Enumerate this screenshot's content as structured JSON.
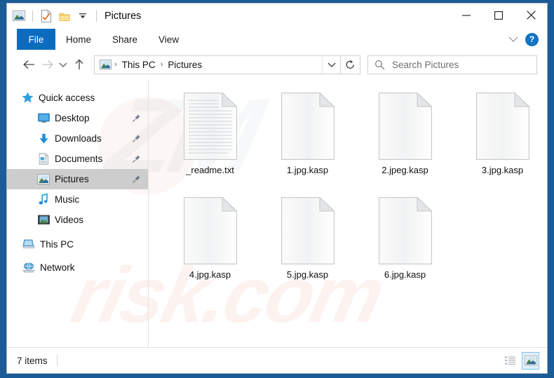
{
  "window": {
    "title": "Pictures",
    "quick_access_toolbar": [
      {
        "name": "pictures-folder-icon",
        "label": "Pictures"
      },
      {
        "name": "properties-icon",
        "label": "Properties"
      },
      {
        "name": "new-folder-icon",
        "label": "New folder"
      },
      {
        "name": "customize-dropdown-icon",
        "label": "Customize Quick Access Toolbar"
      }
    ],
    "controls": {
      "minimize": "—",
      "maximize": "☐",
      "close": "✕"
    }
  },
  "ribbon": {
    "tabs": [
      {
        "label": "File",
        "active": true
      },
      {
        "label": "Home",
        "active": false
      },
      {
        "label": "Share",
        "active": false
      },
      {
        "label": "View",
        "active": false
      }
    ],
    "collapse_icon": "chevron-down-icon",
    "help_label": "?"
  },
  "address": {
    "back_icon": "←",
    "forward_icon": "→",
    "recent_icon": "⌄",
    "up_icon": "↑",
    "breadcrumbs": [
      "This PC",
      "Pictures"
    ],
    "separator": "›",
    "dropdown_icon": "⌄",
    "refresh_icon": "↻"
  },
  "search": {
    "placeholder": "Search Pictures",
    "icon": "search-icon"
  },
  "sidebar": {
    "items": [
      {
        "label": "Quick access",
        "icon": "star-icon",
        "level": "root",
        "pinned": false,
        "selected": false
      },
      {
        "label": "Desktop",
        "icon": "desktop-icon",
        "level": "child",
        "pinned": true,
        "selected": false
      },
      {
        "label": "Downloads",
        "icon": "download-icon",
        "level": "child",
        "pinned": true,
        "selected": false
      },
      {
        "label": "Documents",
        "icon": "documents-icon",
        "level": "child",
        "pinned": true,
        "selected": false
      },
      {
        "label": "Pictures",
        "icon": "pictures-icon",
        "level": "child",
        "pinned": true,
        "selected": true
      },
      {
        "label": "Music",
        "icon": "music-icon",
        "level": "child",
        "pinned": false,
        "selected": false
      },
      {
        "label": "Videos",
        "icon": "videos-icon",
        "level": "child",
        "pinned": false,
        "selected": false
      },
      {
        "label": "This PC",
        "icon": "this-pc-icon",
        "level": "root",
        "pinned": false,
        "selected": false
      },
      {
        "label": "Network",
        "icon": "network-icon",
        "level": "root",
        "pinned": false,
        "selected": false
      }
    ]
  },
  "files": [
    {
      "name": "_readme.txt",
      "type": "text"
    },
    {
      "name": "1.jpg.kasp",
      "type": "blank"
    },
    {
      "name": "2.jpeg.kasp",
      "type": "blank"
    },
    {
      "name": "3.jpg.kasp",
      "type": "blank"
    },
    {
      "name": "4.jpg.kasp",
      "type": "blank"
    },
    {
      "name": "5.jpg.kasp",
      "type": "blank"
    },
    {
      "name": "6.jpg.kasp",
      "type": "blank"
    }
  ],
  "statusbar": {
    "item_count": "7 items",
    "views": [
      {
        "name": "details-view-button",
        "label": "Details view",
        "active": false
      },
      {
        "name": "large-icons-view-button",
        "label": "Large icons view",
        "active": true
      }
    ]
  },
  "watermark": {
    "top": "ZM",
    "bottom": "risk.com"
  },
  "colors": {
    "accent": "#0b6bbf",
    "desktop": "#1b5b96",
    "selection": "#cdcdcd",
    "help": "#1373c4"
  }
}
